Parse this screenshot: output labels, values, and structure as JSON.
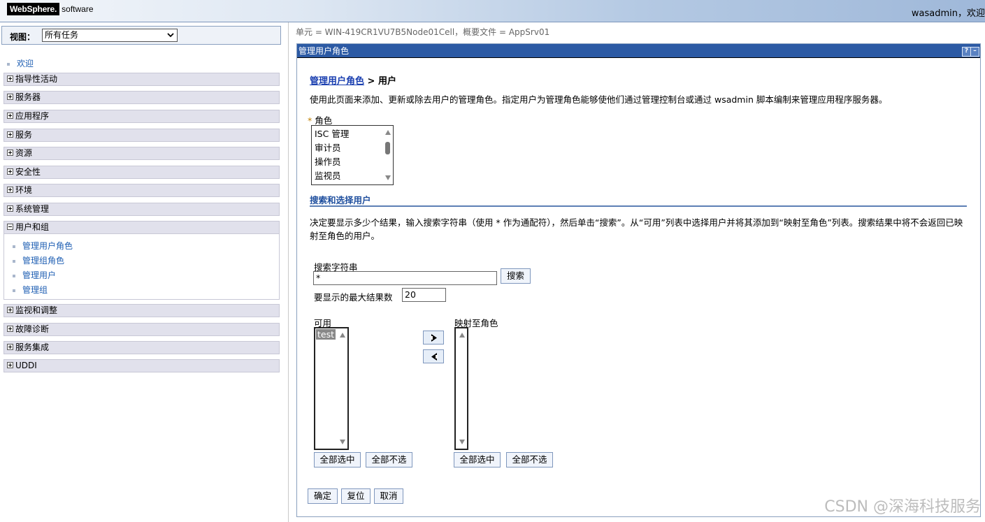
{
  "banner": {
    "brand": "WebSphere.",
    "brand_sub": "software",
    "user_welcome": "wasadmin，欢迎"
  },
  "nav": {
    "view_label": "视图：",
    "view_selected": "所有任务",
    "welcome": "欢迎",
    "groups": [
      "指导性活动",
      "服务器",
      "应用程序",
      "服务",
      "资源",
      "安全性",
      "环境",
      "系统管理",
      "用户和组",
      "监视和调整",
      "故障诊断",
      "服务集成",
      "UDDI"
    ],
    "users_and_groups_items": [
      "管理用户角色",
      "管理组角色",
      "管理用户",
      "管理组"
    ]
  },
  "scope_text": "单元 = WIN-419CR1VU7B5Node01Cell，概要文件 = AppSrv01",
  "panel": {
    "title": "管理用户角色",
    "help": "?",
    "minimize": "–",
    "breadcrumb_link": "管理用户角色",
    "breadcrumb_sep": " > ",
    "breadcrumb_current": "用户",
    "description": "使用此页面来添加、更新或除去用户的管理角色。指定用户为管理角色能够使他们通过管理控制台或通过 wsadmin 脚本编制来管理应用程序服务器。",
    "role_required_mark": "*",
    "role_label": "角色",
    "roles": [
      "ISC 管理",
      "审计员",
      "操作员",
      "监视员"
    ],
    "search_section_title": "搜索和选择用户",
    "search_description": "决定要显示多少个结果，输入搜索字符串（使用 * 作为通配符），然后单击“搜索”。从“可用”列表中选择用户并将其添加到“映射至角色”列表。搜索结果中将不会返回已映射至角色的用户。",
    "search_string_label": "搜索字符串",
    "search_string_value": "*",
    "search_button": "搜索",
    "max_results_label": "要显示的最大结果数",
    "max_results_value": "20",
    "available_label": "可用",
    "available_users": [
      "test"
    ],
    "mapped_label": "映射至角色",
    "mapped_users": [],
    "select_all": "全部选中",
    "deselect_all": "全部不选",
    "ok_button": "确定",
    "reset_button": "复位",
    "cancel_button": "取消"
  },
  "watermark": "CSDN @深海科技服务"
}
